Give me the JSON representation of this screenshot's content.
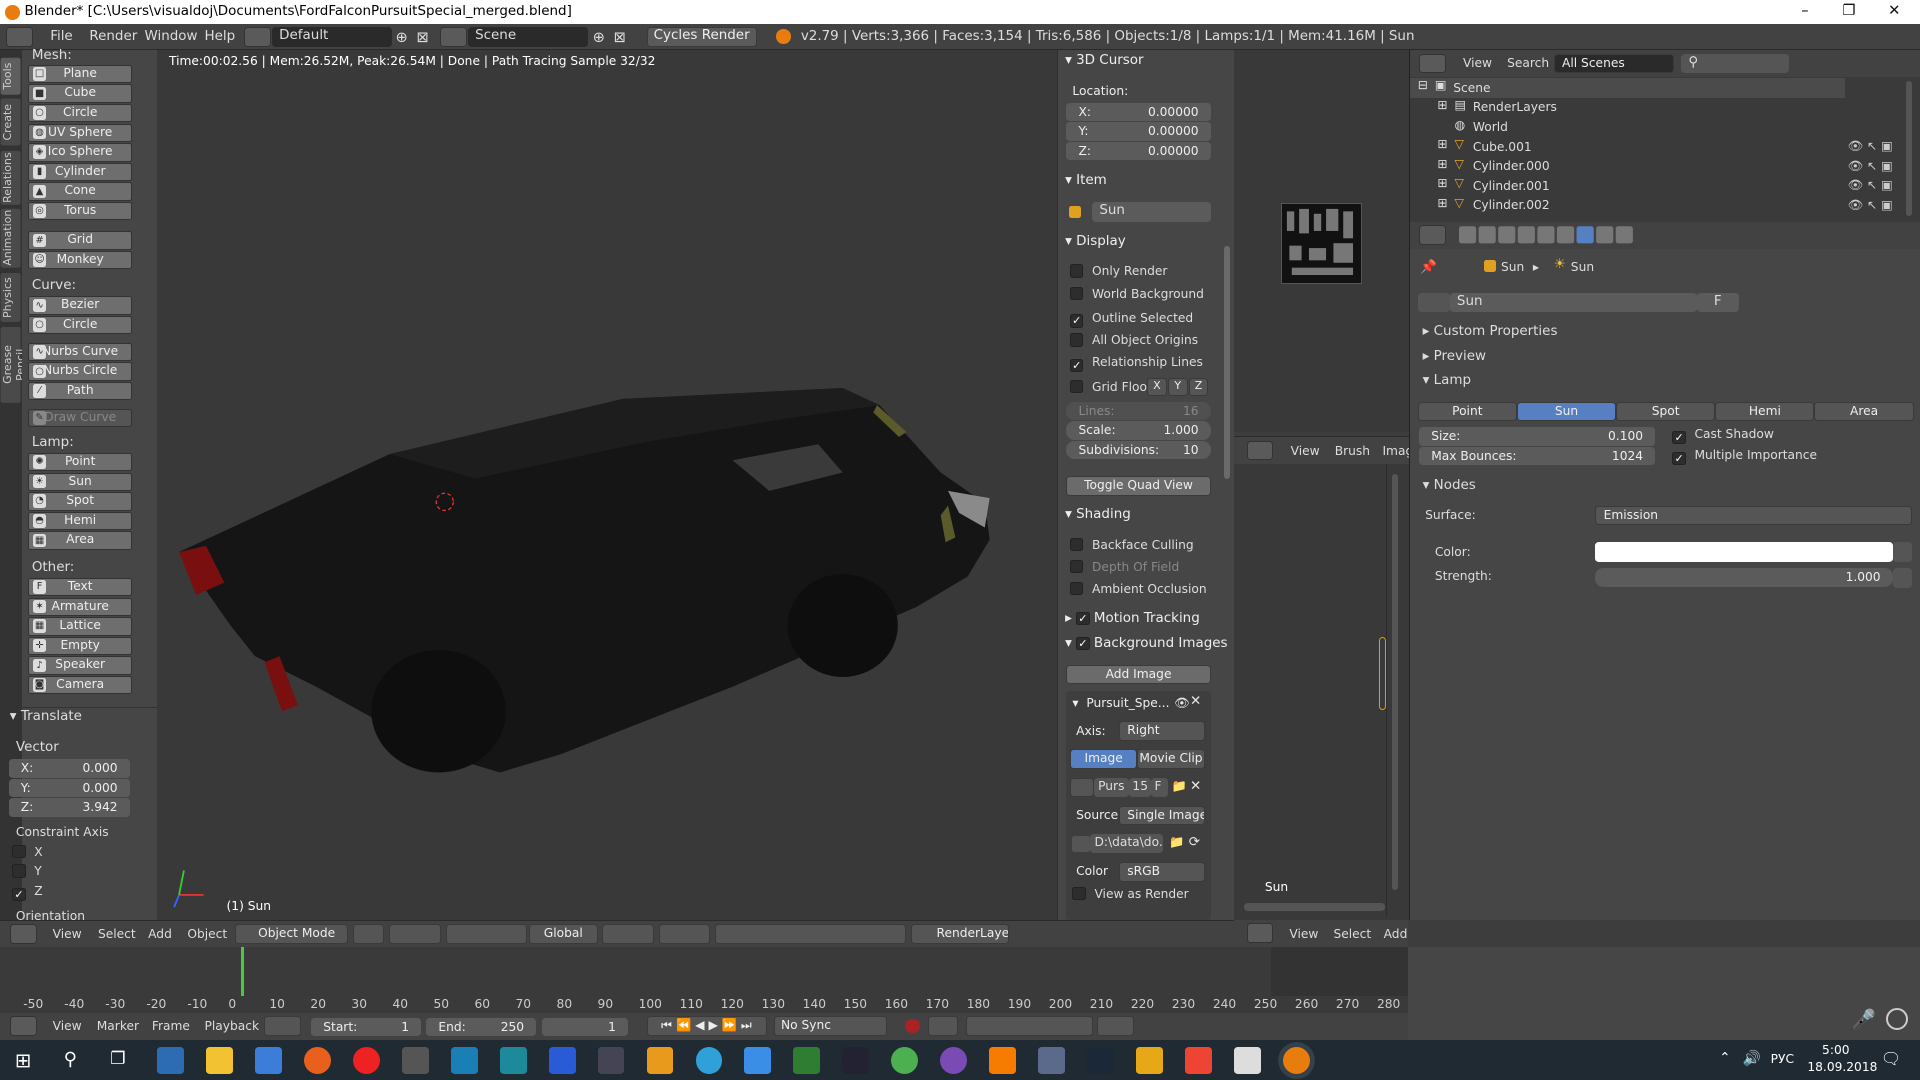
{
  "title_bar": {
    "title": "Blender* [C:\\Users\\visualdoj\\Documents\\FordFalconPursuitSpecial_merged.blend]",
    "minimize": "–",
    "maximize": "❐",
    "close": "✕"
  },
  "info_header": {
    "menus": [
      "File",
      "Render",
      "Window",
      "Help"
    ],
    "screen_layout": "Default",
    "scene": "Scene",
    "render_engine": "Cycles Render",
    "stats": "v2.79 | Verts:3,366 | Faces:3,154 | Tris:6,586 | Objects:1/8 | Lamps:1/1 | Mem:41.16M | Sun"
  },
  "tool_tabs": [
    "Tools",
    "Create",
    "Relations",
    "Animation",
    "Physics",
    "Grease Pencil"
  ],
  "toolshelf": {
    "mesh_label": "Mesh:",
    "mesh": [
      "Plane",
      "Cube",
      "Circle",
      "UV Sphere",
      "Ico Sphere",
      "Cylinder",
      "Cone",
      "Torus",
      "Grid",
      "Monkey"
    ],
    "curve_label": "Curve:",
    "curve": [
      "Bezier",
      "Circle",
      "Nurbs Curve",
      "Nurbs Circle",
      "Path",
      "Draw Curve"
    ],
    "lamp_label": "Lamp:",
    "lamp": [
      "Point",
      "Sun",
      "Spot",
      "Hemi",
      "Area"
    ],
    "other_label": "Other:",
    "other": [
      "Text",
      "Armature",
      "Lattice",
      "Empty",
      "Speaker",
      "Camera"
    ],
    "translate": {
      "header": "Translate",
      "vector_label": "Vector",
      "x_label": "X:",
      "x": "0.000",
      "y_label": "Y:",
      "y": "0.000",
      "z_label": "Z:",
      "z": "3.942",
      "constraint_label": "Constraint Axis",
      "cx": "X",
      "cy": "Y",
      "cz": "Z",
      "orientation_label": "Orientation"
    }
  },
  "viewport": {
    "render_info": "Time:00:02.56 | Mem:26.52M, Peak:26.54M | Done | Path Tracing Sample 32/32",
    "object_label": "(1) Sun"
  },
  "npanel": {
    "cursor": {
      "header": "3D Cursor",
      "location_label": "Location:",
      "x_label": "X:",
      "x": "0.00000",
      "y_label": "Y:",
      "y": "0.00000",
      "z_label": "Z:",
      "z": "0.00000"
    },
    "item": {
      "header": "Item",
      "name": "Sun"
    },
    "display": {
      "header": "Display",
      "only_render": "Only Render",
      "world_background": "World Background",
      "outline_selected": "Outline Selected",
      "all_object_origins": "All Object Origins",
      "relationship_lines": "Relationship Lines",
      "grid_floor": "Grid Floor",
      "gx": "X",
      "gy": "Y",
      "gz": "Z",
      "lines_label": "Lines:",
      "lines": "16",
      "scale_label": "Scale:",
      "scale": "1.000",
      "subdivisions_label": "Subdivisions:",
      "subdivisions": "10",
      "toggle_quad": "Toggle Quad View"
    },
    "shading": {
      "header": "Shading",
      "backface": "Backface Culling",
      "dof": "Depth Of Field",
      "ao": "Ambient Occlusion"
    },
    "motion_tracking": "Motion Tracking",
    "background_images": {
      "header": "Background Images",
      "add_image": "Add Image",
      "image_name": "Pursuit_Spe...",
      "axis_label": "Axis:",
      "axis": "Right",
      "tab_image": "Image",
      "tab_movie": "Movie Clip",
      "img_short": "Purs",
      "img_users": "15",
      "img_f": "F",
      "source_label": "Source",
      "source": "Single Image",
      "filepath": "D:\\data\\do...",
      "color_label": "Color",
      "color_space": "sRGB",
      "view_as_render": "View as Render"
    }
  },
  "viewport_header": {
    "menus": [
      "View",
      "Select",
      "Add",
      "Object"
    ],
    "mode": "Object Mode",
    "orientation": "Global",
    "render_layer": "RenderLayer"
  },
  "image_editor": {
    "menus": [
      "View",
      "Brush",
      "Imag"
    ],
    "label": "Sun",
    "bottom_menus": [
      "View",
      "Select",
      "Add"
    ]
  },
  "outliner": {
    "menus": [
      "View",
      "Search"
    ],
    "filter": "All Scenes",
    "rows": [
      "Scene",
      "RenderLayers",
      "World",
      "Cube.001",
      "Cylinder.000",
      "Cylinder.001",
      "Cylinder.002"
    ]
  },
  "properties": {
    "breadcrumb_a": "Sun",
    "breadcrumb_b": "Sun",
    "datablock": "Sun",
    "datablock_f": "F",
    "custom_properties": "Custom Properties",
    "preview": "Preview",
    "lamp": "Lamp",
    "lamp_types": [
      "Point",
      "Sun",
      "Spot",
      "Hemi",
      "Area"
    ],
    "lamp_active": "Sun",
    "size_label": "Size:",
    "size": "0.100",
    "max_bounces_label": "Max Bounces:",
    "max_bounces": "1024",
    "cast_shadow": "Cast Shadow",
    "multiple_importance": "Multiple Importance",
    "nodes": "Nodes",
    "surface_label": "Surface:",
    "surface": "Emission",
    "color_label": "Color:",
    "strength_label": "Strength:",
    "strength": "1.000"
  },
  "timeline": {
    "ticks": [
      "-50",
      "-40",
      "-30",
      "-20",
      "-10",
      "0",
      "10",
      "20",
      "30",
      "40",
      "50",
      "60",
      "70",
      "80",
      "90",
      "100",
      "110",
      "120",
      "130",
      "140",
      "150",
      "160",
      "170",
      "180",
      "190",
      "200",
      "210",
      "220",
      "230",
      "240",
      "250",
      "260",
      "270",
      "280"
    ],
    "menus": [
      "View",
      "Marker",
      "Frame",
      "Playback"
    ],
    "start_label": "Start:",
    "start": "1",
    "end_label": "End:",
    "end": "250",
    "current": "1",
    "sync": "No Sync"
  },
  "taskbar": {
    "lang": "РУС",
    "time": "5:00",
    "date": "18.09.2018"
  }
}
